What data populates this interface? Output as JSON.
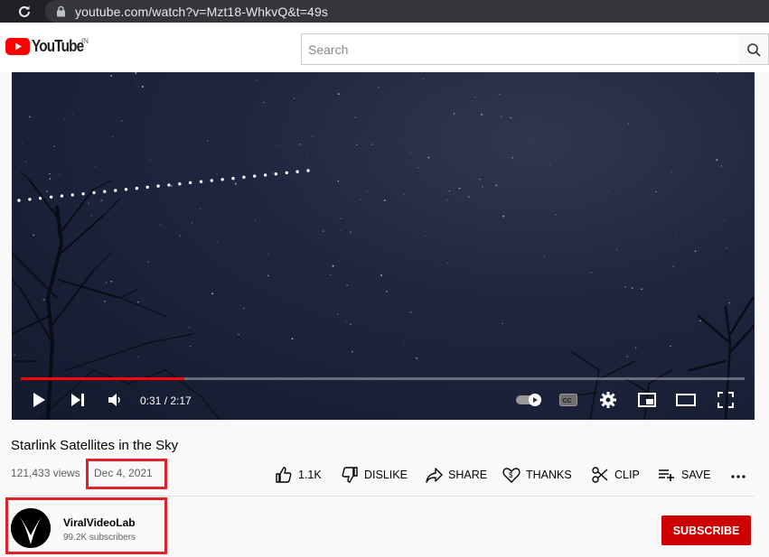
{
  "browser": {
    "url": "youtube.com/watch?v=Mzt18-WhkvQ&t=49s"
  },
  "header": {
    "logo_text": "YouTube",
    "region": "IN",
    "search_placeholder": "Search"
  },
  "player": {
    "time_display": "0:31 / 2:17",
    "progress_fraction": 0.226
  },
  "video": {
    "title": "Starlink Satellites in the Sky",
    "views": "121,433 views",
    "date": "Dec 4, 2021"
  },
  "actions": {
    "like": "1.1K",
    "dislike": "DISLIKE",
    "share": "SHARE",
    "thanks": "THANKS",
    "clip": "CLIP",
    "save": "SAVE"
  },
  "channel": {
    "name": "ViralVideoLab",
    "subscribers": "99.2K subscribers",
    "subscribe_label": "SUBSCRIBE"
  },
  "colors": {
    "brand_red": "#ff0000",
    "subscribe_red": "#cc0000",
    "highlight_red": "#e0202a",
    "browser_dark": "#202124"
  },
  "icons": [
    "reload-icon",
    "lock-icon",
    "youtube-logo-icon",
    "search-icon",
    "play-icon",
    "next-icon",
    "volume-icon",
    "autoplay-toggle-icon",
    "captions-icon",
    "settings-icon",
    "miniplayer-icon",
    "theater-icon",
    "fullscreen-icon",
    "like-icon",
    "dislike-icon",
    "share-icon",
    "thanks-icon",
    "clip-icon",
    "save-icon",
    "more-icon"
  ]
}
